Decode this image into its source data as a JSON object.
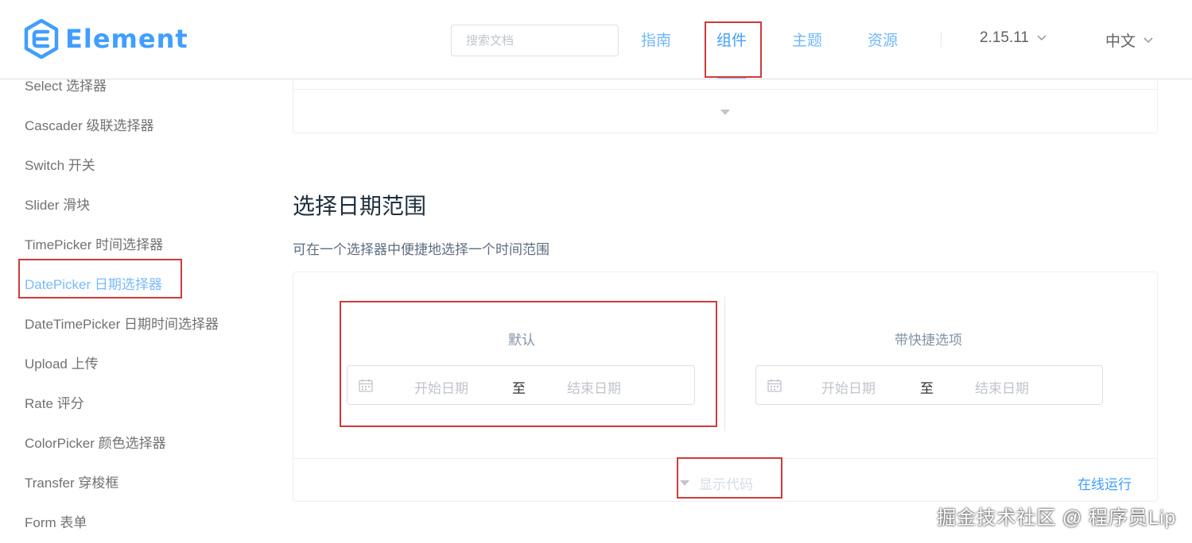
{
  "header": {
    "logo_text": "Element",
    "search_placeholder": "搜索文档",
    "nav": [
      "指南",
      "组件",
      "主题",
      "资源"
    ],
    "version": "2.15.11",
    "language": "中文",
    "colors": {
      "brand": "#409eff",
      "highlight": "#d03a3a"
    }
  },
  "sidebar": {
    "items": [
      "Select 选择器",
      "Cascader 级联选择器",
      "Switch 开关",
      "Slider 滑块",
      "TimePicker 时间选择器",
      "DatePicker 日期选择器",
      "DateTimePicker 日期时间选择器",
      "Upload 上传",
      "Rate 评分",
      "ColorPicker 颜色选择器",
      "Transfer 穿梭框",
      "Form 表单"
    ],
    "active_item": "DatePicker 日期选择器"
  },
  "main": {
    "section_title": "选择日期范围",
    "section_desc": "可在一个选择器中便捷地选择一个时间范围",
    "demo": {
      "left_label": "默认",
      "right_label": "带快捷选项",
      "start_placeholder": "开始日期",
      "range_separator": "至",
      "end_placeholder": "结束日期",
      "show_code": "显示代码",
      "run_online": "在线运行"
    }
  },
  "watermark": "掘金技术社区 @ 程序员Lip"
}
